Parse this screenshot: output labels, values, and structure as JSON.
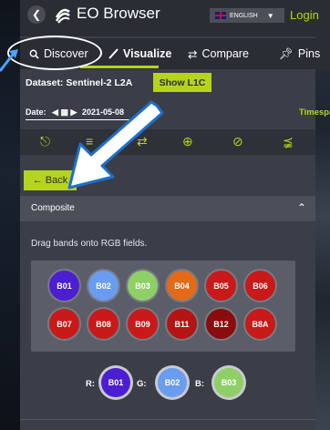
{
  "header": {
    "title": "EO Browser",
    "language": "ENGLISH",
    "login": "Login"
  },
  "tabs": [
    {
      "label": "Discover",
      "icon": "search-icon"
    },
    {
      "label": "Visualize",
      "icon": "brush-icon"
    },
    {
      "label": "Compare",
      "icon": "swap-icon"
    },
    {
      "label": "Pins",
      "icon": "pin-icon"
    }
  ],
  "dataset": {
    "label": "Dataset: Sentinel-2 L2A",
    "show_l1c": "Show L1C"
  },
  "date": {
    "label": "Date:",
    "value": "2021-05-08",
    "timespan": "Timespan"
  },
  "toolbar": [
    "pin-icon",
    "compare-icon",
    "swap-icon",
    "target-icon",
    "eye-off-icon",
    "share-icon"
  ],
  "back_button": "← Back",
  "composite": {
    "title": "Composite",
    "hint": "Drag bands onto RGB fields.",
    "bands": [
      {
        "label": "B01",
        "color": "#4b1fd1"
      },
      {
        "label": "B02",
        "color": "#6a9cf0"
      },
      {
        "label": "B03",
        "color": "#8fcf67"
      },
      {
        "label": "B04",
        "color": "#e36a17"
      },
      {
        "label": "B05",
        "color": "#c91919"
      },
      {
        "label": "B06",
        "color": "#c91919"
      },
      {
        "label": "B07",
        "color": "#c91919"
      },
      {
        "label": "B08",
        "color": "#c91919"
      },
      {
        "label": "B09",
        "color": "#c91919"
      },
      {
        "label": "B11",
        "color": "#b51414"
      },
      {
        "label": "B12",
        "color": "#8a0c0c"
      },
      {
        "label": "B8A",
        "color": "#c91919"
      }
    ],
    "rgb": [
      {
        "channel": "R:",
        "band": "B01",
        "color": "#4b1fd1"
      },
      {
        "channel": "G:",
        "band": "B02",
        "color": "#6a9cf0"
      },
      {
        "channel": "B:",
        "band": "B03",
        "color": "#8fcf67"
      }
    ]
  },
  "colors": {
    "accent": "#b6d31f",
    "panel": "#3b3e49",
    "header": "#2b2d35"
  }
}
